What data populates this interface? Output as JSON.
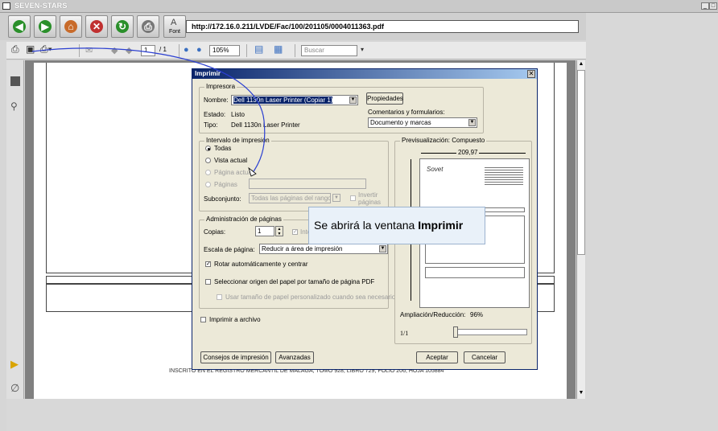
{
  "window": {
    "title": "SEVEN-STARS",
    "min_label": "_",
    "max_label": "□"
  },
  "nav": {
    "buttons": [
      {
        "name": "back-button",
        "icon": "left-arrow-icon",
        "color": "#2a8f2a",
        "glyph": "◀"
      },
      {
        "name": "forward-button",
        "icon": "right-arrow-icon",
        "color": "#2a8f2a",
        "glyph": "▶"
      },
      {
        "name": "home-button",
        "icon": "home-icon",
        "color": "#c86b2a",
        "glyph": "⌂"
      },
      {
        "name": "stop-button",
        "icon": "stop-icon",
        "color": "#c03030",
        "glyph": "✕"
      },
      {
        "name": "refresh-button",
        "icon": "refresh-icon",
        "color": "#2a8f2a",
        "glyph": "↻"
      },
      {
        "name": "print-button",
        "icon": "printer-icon",
        "color": "#777777",
        "glyph": "⎙"
      }
    ],
    "font_button_label": "Font",
    "url": "http://172.16.0.211/LVDE/Fac/100/201105/0004011363.pdf"
  },
  "pdf_toolbar": {
    "page_current": "1",
    "page_total": "/ 1",
    "zoom": "105%",
    "search_placeholder": "Buscar"
  },
  "document": {
    "footer_text": "INSCRITO EN EL REGISTRO MERCANTIL DE MALAGA, TOMO 928, LIBRO 729, FOLIO 206, HOJA 105884"
  },
  "dialog": {
    "title": "Imprimir",
    "printer_group": "Impresora",
    "name_label": "Nombre:",
    "printer_name": "Dell 1130n Laser Printer (Copiar 1)",
    "properties_button": "Propiedades",
    "status_label": "Estado:",
    "status_value": "Listo",
    "type_label": "Tipo:",
    "type_value": "Dell 1130n Laser Printer",
    "comments_label": "Comentarios y formularios:",
    "comments_value": "Documento y marcas",
    "range_group": "Intervalo de impresión",
    "range_all": "Todas",
    "range_current": "Vista actual",
    "range_current_page": "Página actual",
    "range_pages": "Páginas",
    "subset_label": "Subconjunto:",
    "subset_value": "Todas las páginas del rango",
    "reverse_label_1": "Invertir",
    "reverse_label_2": "páginas",
    "handling_group": "Administración de páginas",
    "copies_label": "Copias:",
    "copies_value": "1",
    "collate_label": "Intercalar",
    "scale_label": "Escala de página:",
    "scale_value": "Reducir a área de impresión",
    "autorotate_label": "Rotar automáticamente y centrar",
    "paper_source_label": "Seleccionar origen del papel por tamaño de página PDF",
    "custom_paper_label": "Usar tamaño de papel personalizado cuando sea necesario",
    "print_to_file_label": "Imprimir a archivo",
    "preview_group": "Previsualización: Compuesto",
    "preview_width": "209,97",
    "preview_logo": "Sovet",
    "zoom_label": "Ampliación/Reducción:",
    "zoom_value": "96%",
    "page_indicator": "1/1",
    "tips_button": "Consejos de impresión",
    "advanced_button": "Avanzadas",
    "accept_button": "Aceptar",
    "cancel_button": "Cancelar"
  },
  "tooltip": {
    "text_prefix": "Se abrirá la ventana ",
    "text_bold": "Imprimir"
  }
}
